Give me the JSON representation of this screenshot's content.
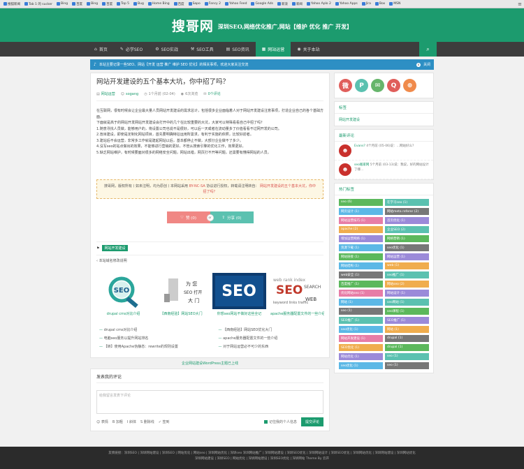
{
  "browser": {
    "bookmarks": [
      "搜狐新闻",
      "Tab 1 的 sucker",
      "Bing",
      "百度",
      "Bing",
      "百度",
      "Top 5",
      "Bug",
      "Home Bing",
      "百度",
      "Sapo",
      "Fancy 2",
      "Yahoo Feed",
      "Google Ads",
      "新浪",
      "新闻",
      "Yahoo Aplo 2",
      "Yahoo Apps",
      "Jira",
      "Box",
      "MSN"
    ],
    "menu_icon": "menu-icon"
  },
  "header": {
    "logo": "搜哥网",
    "slogan": "深圳SEO,网络优化推广,网站【维护 优化 推广 开发】"
  },
  "nav": {
    "items": [
      {
        "label": "首页",
        "icon": "⌂"
      },
      {
        "label": "必学SEO",
        "icon": "✎"
      },
      {
        "label": "SEO实战",
        "icon": "⚙"
      },
      {
        "label": "SEO工具",
        "icon": "⚒"
      },
      {
        "label": "SEO资讯",
        "icon": "▤"
      },
      {
        "label": "网站运营",
        "icon": "▦"
      },
      {
        "label": "关于本站",
        "icon": "◉"
      }
    ],
    "search_icon": "search-icon"
  },
  "notice": {
    "text": "本站主要记录一些SEO、网站【开发 运营 推广 维护 SEO 优化】的相关事项，欢迎大家关注交流",
    "close": "x",
    "close_label": "关闭"
  },
  "post": {
    "title": "网站开发建设的五个基本大坑，你中招了吗？",
    "meta": {
      "category": "网站运营",
      "author": "sogang",
      "date": "1个月前 (02-04)",
      "views": "6次浏览",
      "comments": "0个评论"
    },
    "paragraphs": [
      "在互联网，很有时候会让企业最大量人员网站开发建设的需求总计，包括很多企业面临着人对于网站开发建设注意事项，打造企业自己的各个基础方面。",
      "下面就是高于的网站开发网站开发建设会打开中的几个在比较重要的大坑，大家可以特殊看看自己中招了吗？",
      "1.随意寻找人员做，能够用户的，将设置公司也说不是很好，可以后一天或者在流动量多了价值看看不过网开发的公司。",
      "2.盲目建设，即使是定制化网站项目，首先要明确特征运用所需求，有利于实施的依照，比较好前者。",
      "3.建站后不会运营，非常多工作就是建起网站以后，基本都停止不做，大部分企业做不了多少。",
      "4.没写seo的站点做出的效果，不能够进行营销的更好。不管从搜索引擎的优化工作，效果更好。",
      "5.缺乏网站维护，有时候要面对很多的网络安全问题，网站出错，网页打不开等问题，还需要有懂得网站的人员。"
    ],
    "copyright_prefix": "搜哥网，版权所有丨如未注明，均为原创丨本网站采用",
    "copyright_license": "BY-NC-SA",
    "copyright_mid": "协议进行授权，转载请注明转自：",
    "copyright_link": "网站开发建设的五个基本大坑，你中招了吗？",
    "like_label": "赞 (0)",
    "or_label": "or",
    "share_label": "分享 (0)",
    "tag": "网站开发建设",
    "prev_post": "本站域名修改说明"
  },
  "related": [
    {
      "caption": "drupal cms对比介绍",
      "kind": "seo-lens"
    },
    {
      "caption": "【西南经验】网站SEO大门",
      "kind": "seo-door"
    },
    {
      "caption": "你想seo网站不做好这些全记",
      "kind": "seo-text"
    },
    {
      "caption": "apache服务器配置文件的一些介绍",
      "kind": "search-cloud"
    }
  ],
  "related_links": [
    "drupal cms对比介绍",
    "【西南经验】网站SEO优化大门",
    "电脑seo服务以提升网站排名",
    "apache服务器配置文件的一些介绍",
    "【转】使用Apache伪静态：rewrite的规则设置",
    "对于网站运营必不可少的东西"
  ],
  "ad_text": "企业网站建设WordPress主题已上线",
  "comment": {
    "title": "发表我的评论",
    "placeholder": "给我留言发表下评论",
    "tools": [
      "表情",
      "加粗",
      "斜体",
      "删除线",
      "签到"
    ],
    "remember": "记住我的个人信息",
    "submit": "提交评论"
  },
  "sidebar": {
    "social": [
      {
        "icon": "weibo-icon",
        "glyph": "微",
        "color": "#e05e5b"
      },
      {
        "icon": "tencent-weibo-icon",
        "glyph": "P",
        "color": "#5bc1b0"
      },
      {
        "icon": "wechat-icon",
        "glyph": "✉",
        "color": "#66b56b"
      },
      {
        "icon": "qq-icon",
        "glyph": "Q",
        "color": "#e05e5b"
      },
      {
        "icon": "rss-icon",
        "glyph": "⊕",
        "color": "#f08a4b"
      }
    ],
    "tags_title": "标签",
    "tags_link": "网站开发建设",
    "recent_title": "最新评论",
    "recent": [
      {
        "name": "Evans?",
        "text": "4个月前 (05-06)说：...网站好么？"
      },
      {
        "name": "seo搬家网",
        "text": "5个月前 (03-13)说：我说，好的网站设计了哪..."
      }
    ],
    "cloud_title": "热门标签",
    "cloud": [
      {
        "label": "seo (6)",
        "color": "#5cb85c"
      },
      {
        "label": "在学习seo (1)",
        "color": "#5bc1b0"
      },
      {
        "label": "网页设计 (1)",
        "color": "#5cb8e6"
      },
      {
        "label": "网站meta referer (2)",
        "color": "#777"
      },
      {
        "label": "网站运营技巧 (1)",
        "color": "#e77da7"
      },
      {
        "label": "首页优化 (1)",
        "color": "#9b8ad9"
      },
      {
        "label": "apache (2)",
        "color": "#f0ad4e"
      },
      {
        "label": "企业SEO (2)",
        "color": "#5bc1b0"
      },
      {
        "label": "增加运营网络 (1)",
        "color": "#9b8ad9"
      },
      {
        "label": "网络营销 (1)",
        "color": "#5cb85c"
      },
      {
        "label": "资源下载 (1)",
        "color": "#5cb8e6"
      },
      {
        "label": "seo优化 (1)",
        "color": "#777"
      },
      {
        "label": "网站链接 (1)",
        "color": "#5cb85c"
      },
      {
        "label": "网站运营 (1)",
        "color": "#9b8ad9"
      },
      {
        "label": "网站结构 (1)",
        "color": "#5cb8e6"
      },
      {
        "label": "web (1)",
        "color": "#f0ad4e"
      },
      {
        "label": "web安全 (1)",
        "color": "#777"
      },
      {
        "label": "seo推广 (1)",
        "color": "#5bc1b0"
      },
      {
        "label": "百度推广 (1)",
        "color": "#5cb85c"
      },
      {
        "label": "网站seo (2)",
        "color": "#f0ad4e"
      },
      {
        "label": "优化网站seo (1)",
        "color": "#e77da7"
      },
      {
        "label": "网站设计 (1)",
        "color": "#9b8ad9"
      },
      {
        "label": "网站 (1)",
        "color": "#5cb8e6"
      },
      {
        "label": "seo网站 (1)",
        "color": "#5bc1b0"
      },
      {
        "label": "seo (1)",
        "color": "#777"
      },
      {
        "label": "seo课程 (1)",
        "color": "#5cb85c"
      },
      {
        "label": "SEO推广 (1)",
        "color": "#5bc1b0"
      },
      {
        "label": "SEO推广 (1)",
        "color": "#9b8ad9"
      },
      {
        "label": "seo优化 (1)",
        "color": "#5cb8e6"
      },
      {
        "label": "网站 (1)",
        "color": "#f0ad4e"
      },
      {
        "label": "网站开发建设 (1)",
        "color": "#e77da7"
      },
      {
        "label": "drupal (1)",
        "color": "#777"
      },
      {
        "label": "SEO优化 (1)",
        "color": "#f0ad4e"
      },
      {
        "label": "drupal (1)",
        "color": "#5cb85c"
      },
      {
        "label": "网站优化 (1)",
        "color": "#9b8ad9"
      },
      {
        "label": "seo (1)",
        "color": "#5bc1b0"
      },
      {
        "label": "seo优化 (1)",
        "color": "#5cb8e6"
      },
      {
        "label": "seo (1)",
        "color": "#777"
      }
    ]
  },
  "footer": {
    "line1": "友情链接：深圳SEO | 深圳网站建设 | 深圳SEO | 网站优化 | 网站seo | 深圳网站优化 | 深圳seo 深圳网站推广 | 深圳网站建设 | 深圳SEO优化 | 深圳网站设计 | 深圳SEO优化 | 深圳网站优化 | 深圳网站建设 | 深圳网站优化",
    "line2": "深圳网站建设 | 深圳SEO | 网站优化 | 深圳网站建设 | 深圳SEO优化 | 深圳网站 Theme By 云开"
  }
}
